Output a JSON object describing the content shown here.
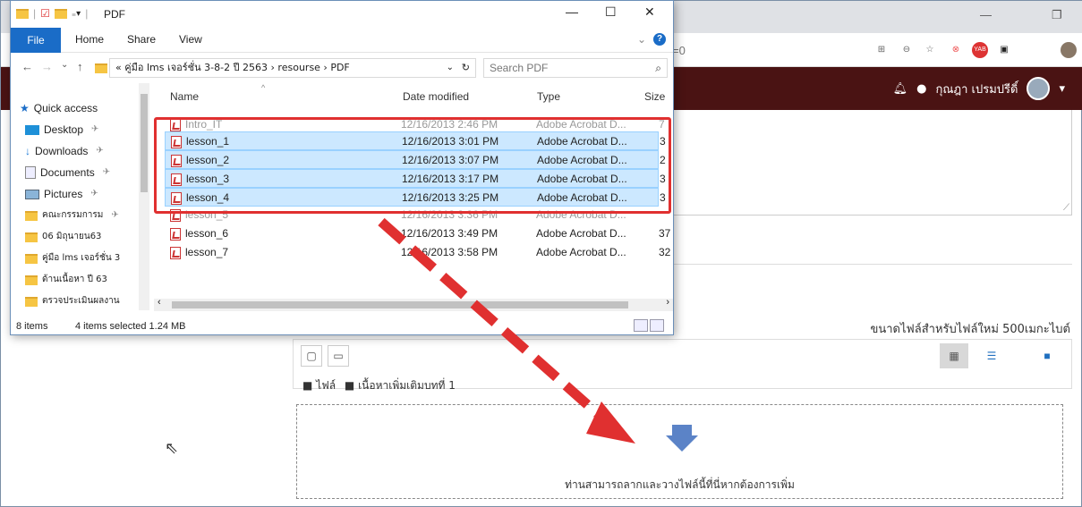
{
  "browser": {
    "address_suffix": "=0",
    "user_name": "กุณฎา เปรมปรีดิ์",
    "max_size_text": "ขนาดไฟล์สำหรับไฟล์ใหม่ 500เมกะไบต์",
    "breadcrumb": [
      "ไฟล์",
      "เนื้อหาเพิ่มเติมบทที่ 1"
    ],
    "drop_text": "ท่านสามารถลากและวางไฟล์นี้ที่นี่หากต้องการเพิ่ม"
  },
  "explorer": {
    "title": "PDF",
    "ribbon_tabs": [
      "File",
      "Home",
      "Share",
      "View"
    ],
    "path": "« คู่มือ lms เจอร์ชั่น 3-8-2 ปี 2563  ›  resourse  ›  PDF",
    "search_placeholder": "Search PDF",
    "nav_items": [
      {
        "label": "Quick access",
        "icon": "star-icon"
      },
      {
        "label": "Desktop",
        "icon": "desktop-icon"
      },
      {
        "label": "Downloads",
        "icon": "download-icon"
      },
      {
        "label": "Documents",
        "icon": "documents-icon"
      },
      {
        "label": "Pictures",
        "icon": "pictures-icon"
      },
      {
        "label": "คณะกรรมการม",
        "icon": "folder-icon"
      },
      {
        "label": "06 มิถุนายน63",
        "icon": "folder-icon"
      },
      {
        "label": "คู่มือ lms เจอร์ชั่น 3",
        "icon": "folder-icon"
      },
      {
        "label": "ด้านเนื้อหา ปี 63",
        "icon": "folder-icon"
      },
      {
        "label": "ตรวจประเมินผลงาน",
        "icon": "folder-icon"
      }
    ],
    "columns": [
      "Name",
      "Date modified",
      "Type",
      "Size"
    ],
    "files": [
      {
        "name": "Intro_IT",
        "date": "12/16/2013 2:46 PM",
        "type": "Adobe Acrobat D...",
        "size": "7",
        "selected": false
      },
      {
        "name": "lesson_1",
        "date": "12/16/2013 3:01 PM",
        "type": "Adobe Acrobat D...",
        "size": "3",
        "selected": true
      },
      {
        "name": "lesson_2",
        "date": "12/16/2013 3:07 PM",
        "type": "Adobe Acrobat D...",
        "size": "2",
        "selected": true
      },
      {
        "name": "lesson_3",
        "date": "12/16/2013 3:17 PM",
        "type": "Adobe Acrobat D...",
        "size": "3",
        "selected": true
      },
      {
        "name": "lesson_4",
        "date": "12/16/2013 3:25 PM",
        "type": "Adobe Acrobat D...",
        "size": "3",
        "selected": true
      },
      {
        "name": "lesson_5",
        "date": "12/16/2013 3:36 PM",
        "type": "Adobe Acrobat D...",
        "size": "",
        "selected": false
      },
      {
        "name": "lesson_6",
        "date": "12/16/2013 3:49 PM",
        "type": "Adobe Acrobat D...",
        "size": "37",
        "selected": false
      },
      {
        "name": "lesson_7",
        "date": "12/16/2013 3:58 PM",
        "type": "Adobe Acrobat D...",
        "size": "32",
        "selected": false
      }
    ],
    "status": {
      "count": "8 items",
      "selected": "4 items selected  1.24 MB"
    }
  },
  "colors": {
    "highlight": "#e03030",
    "navbar": "#4a1313",
    "accent": "#1a6cc7"
  }
}
